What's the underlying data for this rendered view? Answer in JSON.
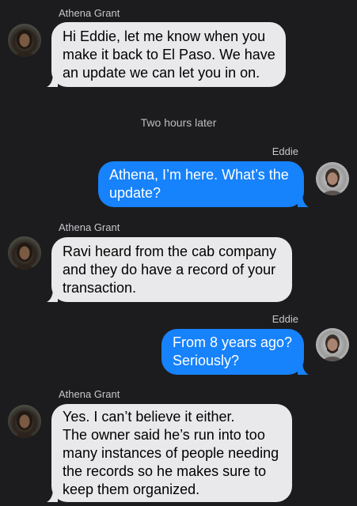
{
  "colors": {
    "background": "#1c1c1e",
    "incoming_bubble": "#e9e9eb",
    "outgoing_bubble": "#1682fb"
  },
  "messages": [
    {
      "sender": "Athena Grant",
      "direction": "incoming",
      "avatar": "athena-avatar",
      "lines": [
        "Hi Eddie, let me know when you",
        "make it back to El Paso. We have",
        "an update we can let you in on."
      ]
    },
    {
      "divider": "Two hours later"
    },
    {
      "sender": "Eddie",
      "direction": "outgoing",
      "avatar": "eddie-avatar",
      "lines": [
        "Athena, I’m here. What’s the",
        "update?"
      ]
    },
    {
      "sender": "Athena Grant",
      "direction": "incoming",
      "avatar": "athena-avatar",
      "lines": [
        "Ravi heard from the cab company",
        "and they do have a record of your",
        "transaction."
      ]
    },
    {
      "sender": "Eddie",
      "direction": "outgoing",
      "avatar": "eddie-avatar",
      "lines": [
        "From 8 years ago?",
        "Seriously?"
      ]
    },
    {
      "sender": "Athena Grant",
      "direction": "incoming",
      "avatar": "athena-avatar",
      "lines": [
        "Yes. I can’t believe it either.",
        "The owner said he’s run into too",
        "many instances of people needing",
        "the records so he makes sure to",
        "keep them organized."
      ]
    }
  ]
}
